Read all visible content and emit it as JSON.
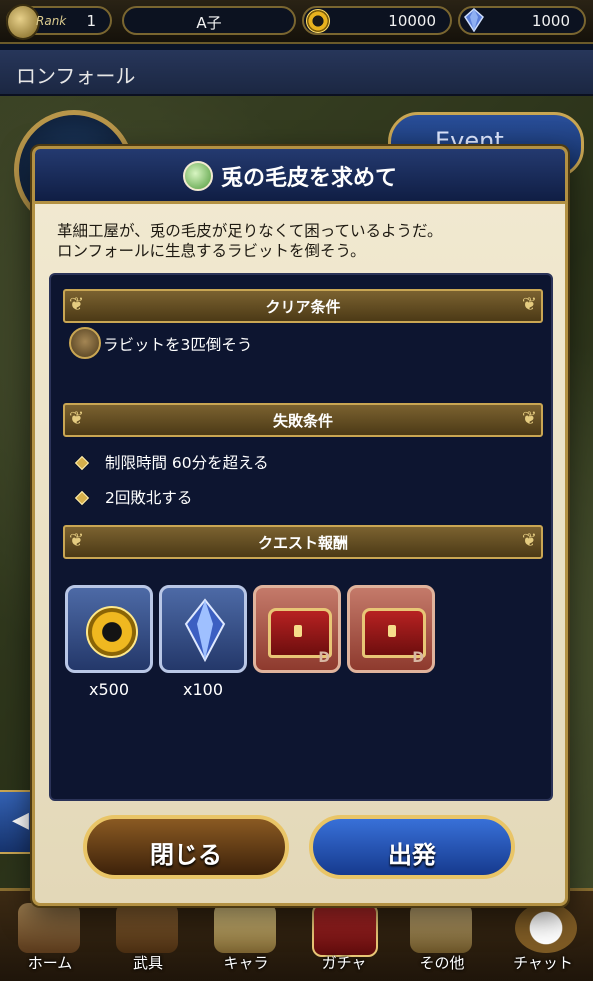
{
  "status": {
    "rank_label": "Rank",
    "rank_value": "1",
    "player_name": "A子",
    "gold": "10000",
    "gems": "1000"
  },
  "location": {
    "name": "ロンフォール"
  },
  "event_button": {
    "label": "Event"
  },
  "quest": {
    "title": "兎の毛皮を求めて",
    "description_line1": "革細工屋が、兎の毛皮が足りなくて困っているようだ。",
    "description_line2": "ロンフォールに生息するラビットを倒そう。",
    "clear_header": "クリア条件",
    "clear_condition": "ラビットを3匹倒そう",
    "fail_header": "失敗条件",
    "fail_conditions": [
      "制限時間 60分を超える",
      "2回敗北する"
    ],
    "reward_header": "クエスト報酬",
    "rewards": [
      {
        "icon": "gold-coin-icon",
        "qty": "x500"
      },
      {
        "icon": "crystal-icon",
        "qty": "x100"
      },
      {
        "icon": "treasure-chest-icon",
        "qty": "",
        "rank": "D"
      },
      {
        "icon": "treasure-chest-icon",
        "qty": "",
        "rank": "D"
      }
    ],
    "close_label": "閉じる",
    "depart_label": "出発"
  },
  "nav": [
    {
      "label": "ホーム",
      "icon": "home-icon"
    },
    {
      "label": "武具",
      "icon": "equipment-icon"
    },
    {
      "label": "キャラ",
      "icon": "character-icon"
    },
    {
      "label": "ガチャ",
      "icon": "gacha-icon"
    },
    {
      "label": "その他",
      "icon": "other-icon"
    },
    {
      "label": "チャット",
      "icon": "chat-icon"
    }
  ],
  "colors": {
    "gold_border": "#b39143",
    "dialog_bg": "#f2ead2",
    "panel_bg": "#0d1530",
    "go_button": "#3870d8"
  }
}
